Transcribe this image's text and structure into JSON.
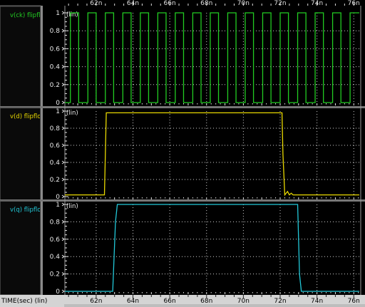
{
  "x_axis": {
    "label": "TIME(sec) (lin)",
    "ticks": [
      "62n",
      "64n",
      "66n",
      "68n",
      "70n",
      "72n",
      "74n",
      "76n"
    ],
    "tick_values": [
      62,
      64,
      66,
      68,
      70,
      72,
      74,
      76
    ],
    "range": [
      60.3,
      76.3
    ],
    "unit": "ns"
  },
  "panels": [
    {
      "label": "v(ck) flipflop",
      "scale_label": "(lin)",
      "color": "#22cc22",
      "y_ticks": [
        "0",
        "0.2",
        "0.4",
        "0.6",
        "0.8",
        "1"
      ],
      "y_range": [
        0,
        1
      ]
    },
    {
      "label": "v(d) flipflop",
      "scale_label": "(lin)",
      "color": "#e8d800",
      "y_ticks": [
        "0",
        "0.2",
        "0.4",
        "0.6",
        "0.8",
        "1"
      ],
      "y_range": [
        0,
        1
      ]
    },
    {
      "label": "v(q) flipflop",
      "scale_label": "(lin)",
      "color": "#22c8d8",
      "y_ticks": [
        "0",
        "0.2",
        "0.4",
        "0.6",
        "0.8",
        "1"
      ],
      "y_range": [
        0,
        1
      ]
    }
  ],
  "chart_data": {
    "type": "line",
    "title": "",
    "xlabel": "TIME(sec) (lin)",
    "ylabel": "",
    "xlim": [
      60.3,
      76.3
    ],
    "ylim": [
      0,
      1
    ],
    "grid": true,
    "series": [
      {
        "name": "v(ck) flipflop",
        "x": [
          60.3,
          60.6,
          60.6,
          61.05,
          61.05,
          61.55,
          61.55,
          62.0,
          62.0,
          62.5,
          62.5,
          62.95,
          62.95,
          63.45,
          63.45,
          63.9,
          63.9,
          64.4,
          64.4,
          64.85,
          64.85,
          65.35,
          65.35,
          65.8,
          65.8,
          66.3,
          66.3,
          66.75,
          66.75,
          67.25,
          67.25,
          67.7,
          67.7,
          68.2,
          68.2,
          68.65,
          68.65,
          69.15,
          69.15,
          69.6,
          69.6,
          70.1,
          70.1,
          70.55,
          70.55,
          71.05,
          71.05,
          71.5,
          71.5,
          72.0,
          72.0,
          72.45,
          72.45,
          72.95,
          72.95,
          73.4,
          73.4,
          73.9,
          73.9,
          74.35,
          74.35,
          74.85,
          74.85,
          75.3,
          75.3,
          75.8,
          75.8,
          76.3
        ],
        "y": [
          0,
          0,
          1,
          1,
          0,
          0,
          1,
          1,
          0,
          0,
          1,
          1,
          0,
          0,
          1,
          1,
          0,
          0,
          1,
          1,
          0,
          0,
          1,
          1,
          0,
          0,
          1,
          1,
          0,
          0,
          1,
          1,
          0,
          0,
          1,
          1,
          0,
          0,
          1,
          1,
          0,
          0,
          1,
          1,
          0,
          0,
          1,
          1,
          0,
          0,
          1,
          1,
          0,
          0,
          1,
          1,
          0,
          0,
          1,
          1,
          0,
          0,
          1,
          1,
          0,
          0,
          1,
          1
        ]
      },
      {
        "name": "v(d) flipflop",
        "x": [
          60.3,
          62.45,
          62.55,
          62.6,
          72.1,
          72.15,
          72.25,
          72.4,
          72.5,
          72.6,
          72.7,
          76.3
        ],
        "y": [
          0.02,
          0.02,
          0.98,
          0.98,
          0.98,
          0.5,
          0.02,
          0.06,
          0.02,
          0.04,
          0.02,
          0.02
        ]
      },
      {
        "name": "v(q) flipflop",
        "x": [
          60.3,
          62.9,
          63.05,
          63.15,
          72.95,
          73.05,
          73.15,
          76.3
        ],
        "y": [
          0,
          0,
          0.8,
          1,
          1,
          0.2,
          0,
          0
        ]
      }
    ]
  },
  "menu_stub": {
    "text": ""
  }
}
